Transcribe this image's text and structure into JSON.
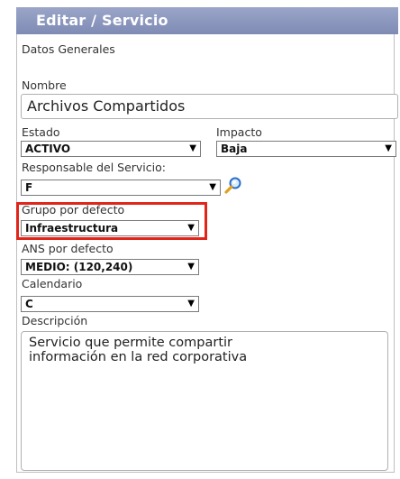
{
  "window": {
    "title": "Editar / Servicio"
  },
  "section": {
    "heading": "Datos Generales"
  },
  "form": {
    "nombre": {
      "label": "Nombre",
      "value": "Archivos Compartidos"
    },
    "estado": {
      "label": "Estado",
      "value": "ACTIVO"
    },
    "impacto": {
      "label": "Impacto",
      "value": "Baja"
    },
    "responsable": {
      "label": "Responsable del Servicio:",
      "value": "F",
      "search_icon": "search-icon"
    },
    "grupo": {
      "label": "Grupo por defecto",
      "value": "Infraestructura"
    },
    "ans": {
      "label": "ANS por defecto",
      "value": "MEDIO: (120,240)"
    },
    "calendario": {
      "label": "Calendario",
      "value": "C"
    },
    "descripcion": {
      "label": "Descripción",
      "value": "Servicio que permite compartir\ninformación en la red corporativa"
    }
  },
  "colors": {
    "title_bar": "#8c97c0",
    "highlight": "#e1251b"
  }
}
